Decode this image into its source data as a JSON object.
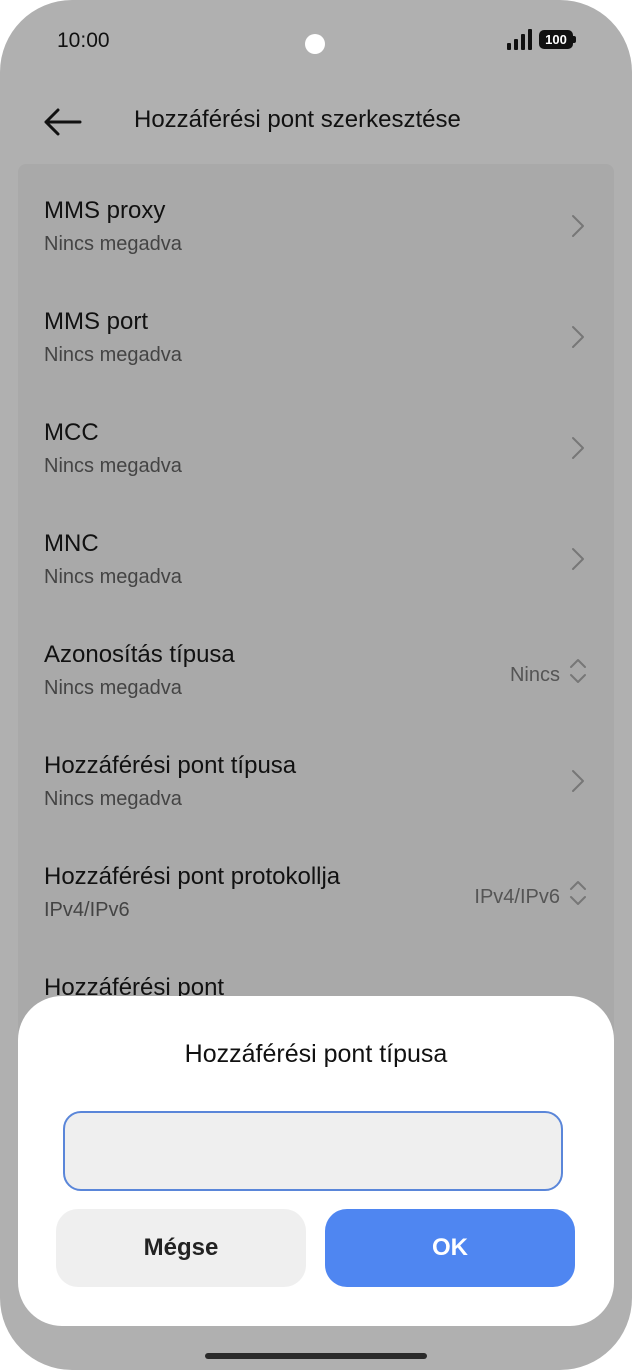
{
  "status_bar": {
    "time": "10:00",
    "battery": "100"
  },
  "header": {
    "title": "Hozzáférési pont szerkesztése"
  },
  "settings": [
    {
      "title": "MMS proxy",
      "subtitle": "Nincs megadva",
      "value": "",
      "control": "chevron"
    },
    {
      "title": "MMS port",
      "subtitle": "Nincs megadva",
      "value": "",
      "control": "chevron"
    },
    {
      "title": "MCC",
      "subtitle": "Nincs megadva",
      "value": "",
      "control": "chevron"
    },
    {
      "title": "MNC",
      "subtitle": "Nincs megadva",
      "value": "",
      "control": "chevron"
    },
    {
      "title": "Azonosítás típusa",
      "subtitle": "Nincs megadva",
      "value": "Nincs",
      "control": "dropdown"
    },
    {
      "title": "Hozzáférési pont típusa",
      "subtitle": "Nincs megadva",
      "value": "",
      "control": "chevron"
    },
    {
      "title": "Hozzáférési pont protokollja",
      "subtitle": "IPv4/IPv6",
      "value": "IPv4/IPv6",
      "control": "dropdown"
    },
    {
      "title": "Hozzáférési pont",
      "subtitle": "",
      "value": "",
      "control": "none"
    }
  ],
  "dialog": {
    "title": "Hozzáférési pont típusa",
    "input_value": "",
    "cancel_label": "Mégse",
    "ok_label": "OK"
  },
  "colors": {
    "accent": "#4f86f1",
    "overlay_background": "#b0b0b0",
    "input_border": "#5a86d9"
  }
}
